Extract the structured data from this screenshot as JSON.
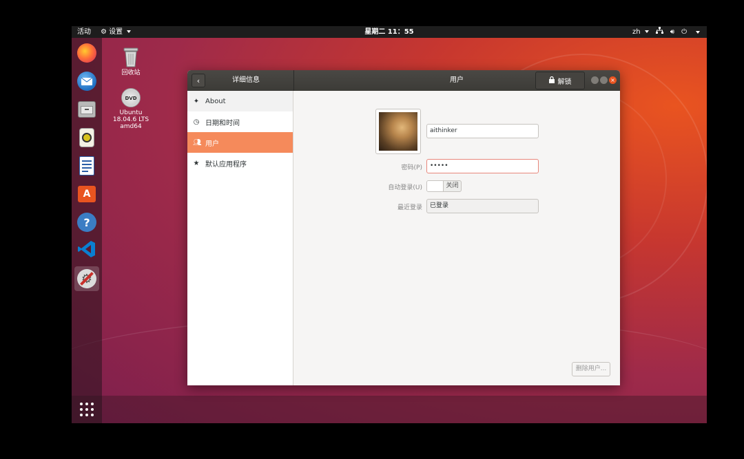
{
  "topbar": {
    "activities": "活动",
    "app_menu": "设置",
    "clock": "星期二 11：55",
    "input_method": "zh"
  },
  "desktop": {
    "trash_label": "回收站",
    "dvd_label_line1": "Ubuntu",
    "dvd_label_line2": "18.04.6 LTS",
    "dvd_label_line3": "amd64"
  },
  "dock": {
    "items": [
      "firefox-icon",
      "thunderbird-icon",
      "files-icon",
      "rhythmbox-icon",
      "libreoffice-writer-icon",
      "software-center-icon",
      "help-icon",
      "vscode-icon",
      "settings-icon"
    ],
    "active": "settings-icon"
  },
  "window": {
    "sidebar_title": "详细信息",
    "title": "用户",
    "unlock_label": "解锁",
    "sidebar": {
      "items": [
        {
          "label": "About",
          "icon": "star-burst-icon"
        },
        {
          "label": "日期和时间",
          "icon": "clock-icon"
        },
        {
          "label": "用户",
          "icon": "users-icon",
          "selected": true
        },
        {
          "label": "默认应用程序",
          "icon": "star-icon"
        }
      ]
    },
    "user": {
      "username": "aithinker",
      "password_label": "密码(P)",
      "password_value": "•••••",
      "autologin_label": "自动登录(U)",
      "autologin_state": "关闭",
      "last_login_label": "最近登录",
      "last_login_value": "已登录",
      "remove_button": "删除用户..."
    }
  },
  "colors": {
    "accent": "#f58a5b",
    "ubuntu_orange": "#e95420",
    "titlebar": "#3c3b37"
  }
}
